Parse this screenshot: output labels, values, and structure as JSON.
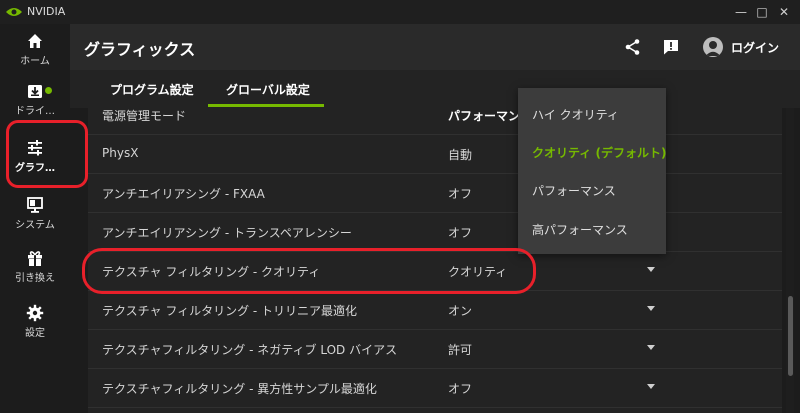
{
  "window": {
    "app_name": "NVIDIA",
    "minimize": "—",
    "maximize": "□",
    "close": "✕"
  },
  "sidebar": {
    "items": [
      {
        "label": "ホーム",
        "icon": "home-icon"
      },
      {
        "label": "ドライ…",
        "icon": "download-icon",
        "badge": true
      },
      {
        "label": "グラフ…",
        "icon": "sliders-icon",
        "active": true
      },
      {
        "label": "システム",
        "icon": "monitor-icon"
      },
      {
        "label": "引き換え",
        "icon": "gift-icon"
      },
      {
        "label": "設定",
        "icon": "gear-icon"
      }
    ]
  },
  "header": {
    "title": "グラフィックス",
    "login": "ログイン"
  },
  "tabs": [
    {
      "label": "プログラム設定",
      "active": false
    },
    {
      "label": "グローバル設定",
      "active": true
    }
  ],
  "settings": [
    {
      "label": "電源管理モード",
      "value": "パフォーマンス"
    },
    {
      "label": "PhysX",
      "value": "自動"
    },
    {
      "label": "アンチエイリアシング - FXAA",
      "value": "オフ"
    },
    {
      "label": "アンチエイリアシング - トランスペアレンシー",
      "value": "オフ"
    },
    {
      "label": "テクスチャ フィルタリング - クオリティ",
      "value": "クオリティ"
    },
    {
      "label": "テクスチャ フィルタリング - トリリニア最適化",
      "value": "オン"
    },
    {
      "label": "テクスチャフィルタリング - ネガティブ LOD バイアス",
      "value": "許可"
    },
    {
      "label": "テクスチャフィルタリング - 異方性サンプル最適化",
      "value": "オフ"
    }
  ],
  "dropdown": {
    "options": [
      {
        "label": "ハイ クオリティ",
        "selected": false
      },
      {
        "label": "クオリティ (デフォルト)",
        "selected": true
      },
      {
        "label": "パフォーマンス",
        "selected": false
      },
      {
        "label": "高パフォーマンス",
        "selected": false
      }
    ]
  },
  "colors": {
    "accent": "#76b900",
    "highlight": "#e8202a",
    "background": "#1c1c1c",
    "header": "#2a2a2a",
    "dropdown": "#3c3c3c"
  }
}
